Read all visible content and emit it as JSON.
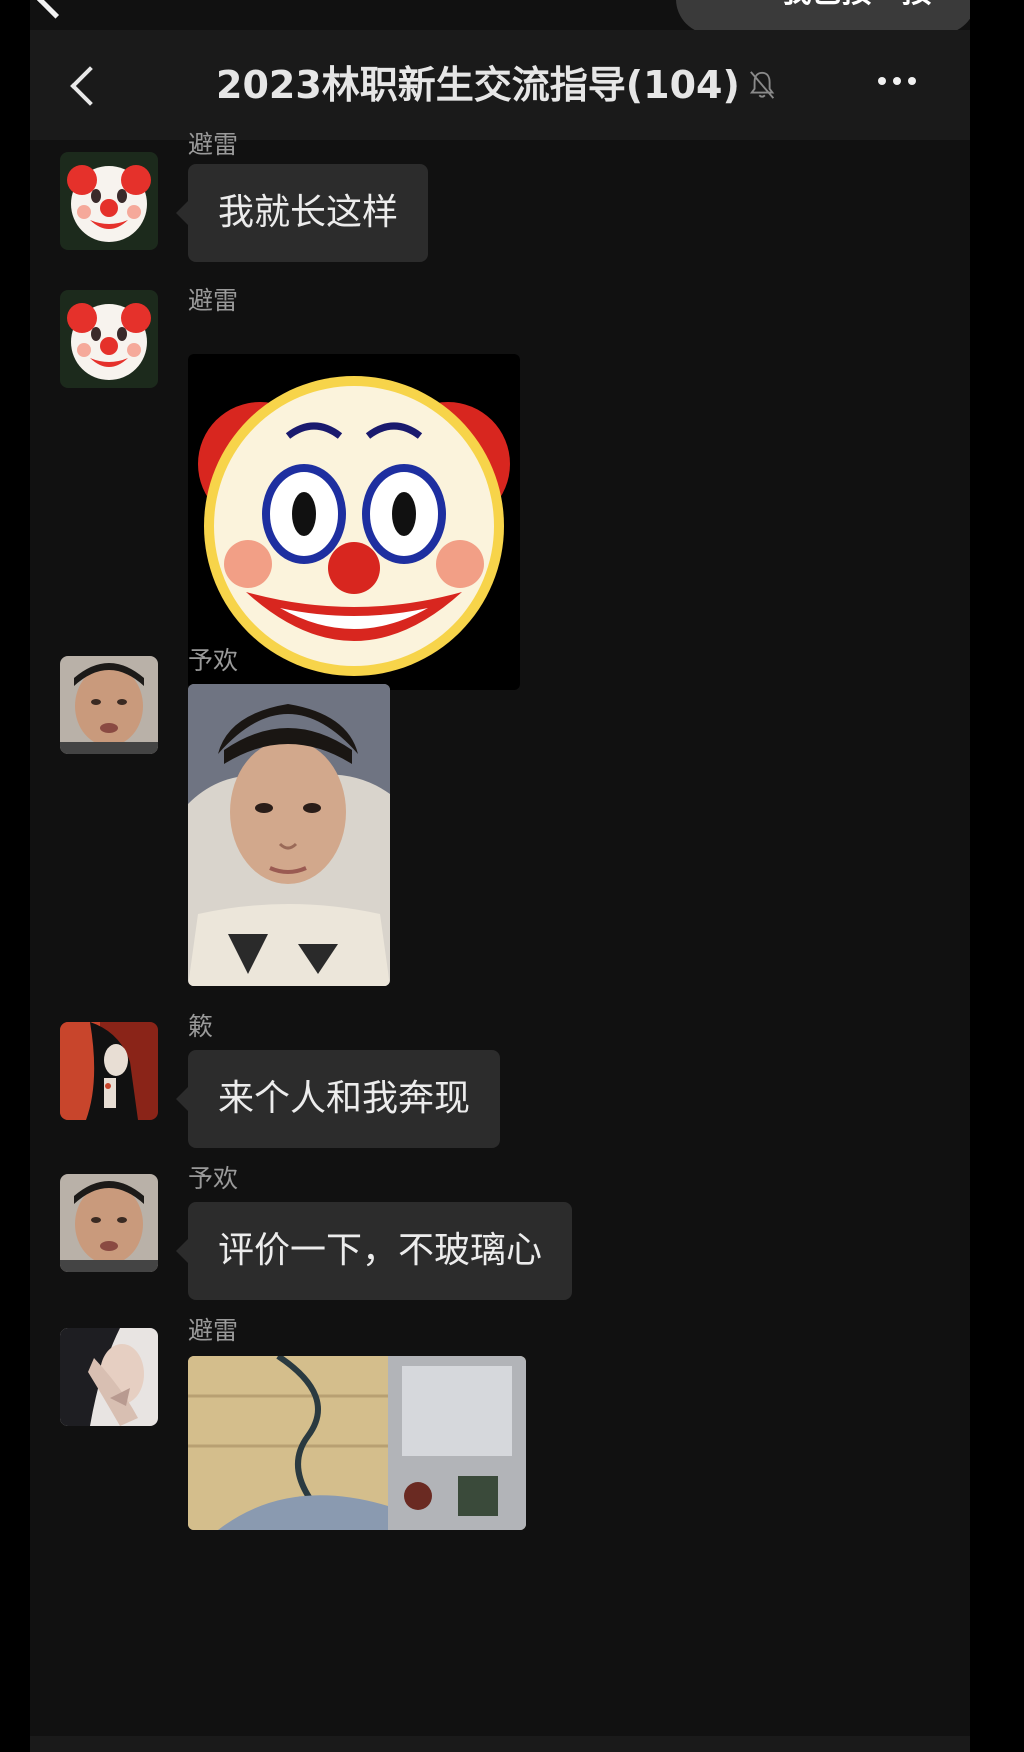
{
  "topbar": {
    "pill_text": "✓ 我已按一按"
  },
  "header": {
    "title": "2023林职新生交流指导(104)",
    "mute_icon": "bell-slash-icon",
    "more_icon": "ellipsis-icon"
  },
  "messages": [
    {
      "sender": "避雷",
      "type": "text",
      "text": "我就长这样",
      "avatar": "clown-emoji"
    },
    {
      "sender": "避雷",
      "type": "image",
      "image": "clown-emoji-sticker",
      "avatar": "clown-emoji"
    },
    {
      "sender": "予欢",
      "type": "image",
      "image": "selfie-photo",
      "avatar": "selfie-photo"
    },
    {
      "sender": "簌",
      "type": "text",
      "text": "来个人和我奔现",
      "avatar": "anime-avatar"
    },
    {
      "sender": "予欢",
      "type": "text",
      "text": "评价一下，不玻璃心",
      "avatar": "selfie-photo"
    },
    {
      "sender": "避雷",
      "type": "image",
      "image": "room-photo",
      "avatar": "girl-photo"
    }
  ],
  "colors": {
    "background": "#111111",
    "bubble": "#2c2c2c",
    "text": "#ececec",
    "sender": "#9a9a9a"
  }
}
